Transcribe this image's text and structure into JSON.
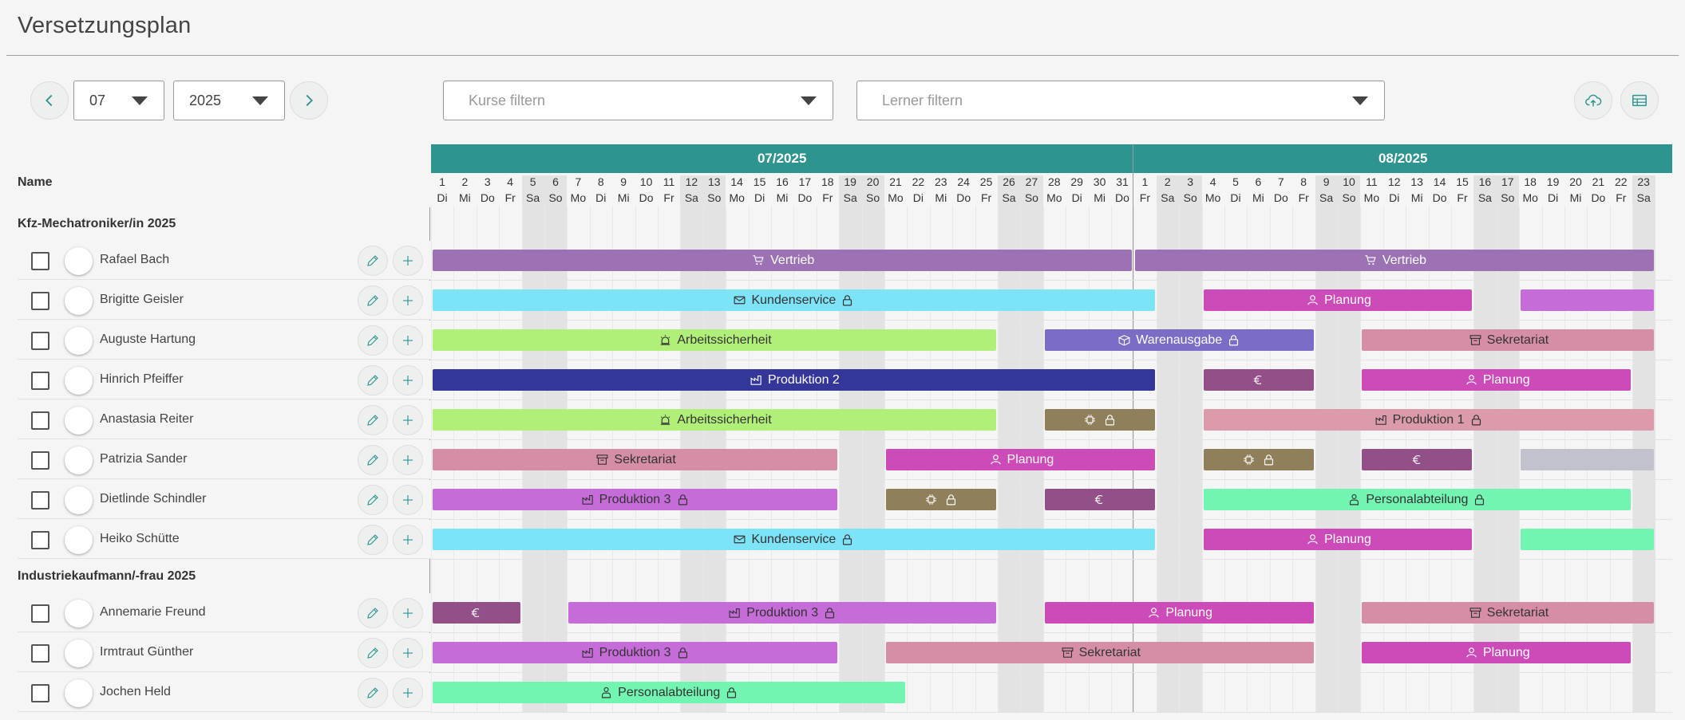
{
  "page_title": "Versetzungsplan",
  "toolbar": {
    "month_value": "07",
    "year_value": "2025",
    "courses_filter_placeholder": "Kurse filtern",
    "learners_filter_placeholder": "Lerner filtern",
    "prev_icon": "chevron-left-icon",
    "next_icon": "chevron-right-icon",
    "upload_icon": "cloud-upload-icon",
    "table_icon": "table-icon"
  },
  "name_column_header": "Name",
  "months": [
    {
      "label": "07/2025",
      "start_day": 1,
      "days": 31,
      "first_weekday_index": 1
    },
    {
      "label": "08/2025",
      "start_day": 1,
      "days": 23,
      "first_weekday_index": 4
    }
  ],
  "weekday_labels": [
    "Mo",
    "Di",
    "Mi",
    "Do",
    "Fr",
    "Sa",
    "So"
  ],
  "groups": [
    {
      "label": "Kfz-Mechatroniker/in 2025",
      "rows": [
        {
          "name": "Rafael Bach",
          "bars": [
            {
              "start": 0,
              "end": 31,
              "label": "Vertrieb",
              "icon": "cart-icon",
              "locked": false,
              "color": "#9c72b5",
              "text": "#ffffff"
            },
            {
              "start": 31,
              "end": 54,
              "label": "Vertrieb",
              "icon": "cart-icon",
              "locked": false,
              "color": "#9c72b5",
              "text": "#ffffff"
            }
          ]
        },
        {
          "name": "Brigitte Geisler",
          "bars": [
            {
              "start": 0,
              "end": 32,
              "label": "Kundenservice",
              "icon": "envelope-icon",
              "locked": true,
              "color": "#7de3f7",
              "text": "#333333"
            },
            {
              "start": 34,
              "end": 46,
              "label": "Planung",
              "icon": "user-icon",
              "locked": false,
              "color": "#cd4bb8",
              "text": "#ffffff"
            },
            {
              "start": 48,
              "end": 54,
              "label": "",
              "icon": "",
              "locked": false,
              "color": "#c66cd9",
              "text": "#ffffff"
            }
          ]
        },
        {
          "name": "Auguste Hartung",
          "bars": [
            {
              "start": 0,
              "end": 25,
              "label": "Arbeitssicherheit",
              "icon": "alarm-icon",
              "locked": false,
              "color": "#b0ef78",
              "text": "#333333"
            },
            {
              "start": 27,
              "end": 39,
              "label": "Warenausgabe",
              "icon": "box-icon",
              "locked": true,
              "color": "#7b6cc6",
              "text": "#ffffff"
            },
            {
              "start": 41,
              "end": 54,
              "label": "Sekretariat",
              "icon": "archive-icon",
              "locked": false,
              "color": "#d58ea6",
              "text": "#333333"
            }
          ]
        },
        {
          "name": "Hinrich Pfeiffer",
          "bars": [
            {
              "start": 0,
              "end": 32,
              "label": "Produktion 2",
              "icon": "factory-icon",
              "locked": false,
              "color": "#35369a",
              "text": "#ffffff"
            },
            {
              "start": 34,
              "end": 39,
              "label": "",
              "icon": "euro-icon",
              "locked": false,
              "color": "#924f88",
              "text": "#ffffff"
            },
            {
              "start": 41,
              "end": 53,
              "label": "Planung",
              "icon": "user-icon",
              "locked": false,
              "color": "#cd4bb8",
              "text": "#ffffff"
            }
          ]
        },
        {
          "name": "Anastasia Reiter",
          "bars": [
            {
              "start": 0,
              "end": 25,
              "label": "Arbeitssicherheit",
              "icon": "alarm-icon",
              "locked": false,
              "color": "#b0ef78",
              "text": "#333333"
            },
            {
              "start": 27,
              "end": 32,
              "label": "",
              "icon": "chip-icon",
              "locked": true,
              "color": "#8f7f5a",
              "text": "#ffffff"
            },
            {
              "start": 34,
              "end": 54,
              "label": "Produktion 1",
              "icon": "factory-icon",
              "locked": true,
              "color": "#db9bab",
              "text": "#333333"
            }
          ]
        },
        {
          "name": "Patrizia Sander",
          "bars": [
            {
              "start": 0,
              "end": 18,
              "label": "Sekretariat",
              "icon": "archive-icon",
              "locked": false,
              "color": "#d58ea6",
              "text": "#333333"
            },
            {
              "start": 20,
              "end": 32,
              "label": "Planung",
              "icon": "user-icon",
              "locked": false,
              "color": "#cd4bb8",
              "text": "#ffffff"
            },
            {
              "start": 34,
              "end": 39,
              "label": "",
              "icon": "chip-icon",
              "locked": true,
              "color": "#8f7f5a",
              "text": "#ffffff"
            },
            {
              "start": 41,
              "end": 46,
              "label": "",
              "icon": "euro-icon",
              "locked": false,
              "color": "#924f88",
              "text": "#ffffff"
            },
            {
              "start": 48,
              "end": 54,
              "label": "",
              "icon": "",
              "locked": false,
              "color": "#c2c2cc",
              "text": "#333333"
            }
          ]
        },
        {
          "name": "Dietlinde Schindler",
          "bars": [
            {
              "start": 0,
              "end": 18,
              "label": "Produktion 3",
              "icon": "factory-icon",
              "locked": true,
              "color": "#c66cd9",
              "text": "#333333"
            },
            {
              "start": 20,
              "end": 25,
              "label": "",
              "icon": "chip-icon",
              "locked": true,
              "color": "#8f7f5a",
              "text": "#ffffff"
            },
            {
              "start": 27,
              "end": 32,
              "label": "",
              "icon": "euro-icon",
              "locked": false,
              "color": "#924f88",
              "text": "#ffffff"
            },
            {
              "start": 34,
              "end": 53,
              "label": "Personalabteilung",
              "icon": "person-icon",
              "locked": true,
              "color": "#72f5b1",
              "text": "#333333"
            }
          ]
        },
        {
          "name": "Heiko Schütte",
          "bars": [
            {
              "start": 0,
              "end": 32,
              "label": "Kundenservice",
              "icon": "envelope-icon",
              "locked": true,
              "color": "#7de3f7",
              "text": "#333333"
            },
            {
              "start": 34,
              "end": 46,
              "label": "Planung",
              "icon": "user-icon",
              "locked": false,
              "color": "#cd4bb8",
              "text": "#ffffff"
            },
            {
              "start": 48,
              "end": 54,
              "label": "",
              "icon": "",
              "locked": false,
              "color": "#72f5b1",
              "text": "#333333"
            }
          ]
        }
      ]
    },
    {
      "label": "Industriekaufmann/-frau 2025",
      "rows": [
        {
          "name": "Annemarie Freund",
          "bars": [
            {
              "start": 0,
              "end": 4,
              "label": "",
              "icon": "euro-icon",
              "locked": false,
              "color": "#924f88",
              "text": "#ffffff"
            },
            {
              "start": 6,
              "end": 25,
              "label": "Produktion 3",
              "icon": "factory-icon",
              "locked": true,
              "color": "#c66cd9",
              "text": "#333333"
            },
            {
              "start": 27,
              "end": 39,
              "label": "Planung",
              "icon": "user-icon",
              "locked": false,
              "color": "#cd4bb8",
              "text": "#ffffff"
            },
            {
              "start": 41,
              "end": 54,
              "label": "Sekretariat",
              "icon": "archive-icon",
              "locked": false,
              "color": "#d58ea6",
              "text": "#333333"
            }
          ]
        },
        {
          "name": "Irmtraut Günther",
          "bars": [
            {
              "start": 0,
              "end": 18,
              "label": "Produktion 3",
              "icon": "factory-icon",
              "locked": true,
              "color": "#c66cd9",
              "text": "#333333"
            },
            {
              "start": 20,
              "end": 39,
              "label": "Sekretariat",
              "icon": "archive-icon",
              "locked": false,
              "color": "#d58ea6",
              "text": "#333333"
            },
            {
              "start": 41,
              "end": 53,
              "label": "Planung",
              "icon": "user-icon",
              "locked": false,
              "color": "#cd4bb8",
              "text": "#ffffff"
            }
          ]
        },
        {
          "name": "Jochen Held",
          "bars": [
            {
              "start": 0,
              "end": 21,
              "label": "Personalabteilung",
              "icon": "person-icon",
              "locked": true,
              "color": "#72f5b1",
              "text": "#333333"
            }
          ]
        }
      ]
    }
  ],
  "row_icons": {
    "edit": "pencil-icon",
    "add": "plus-icon",
    "lock": "lock-icon"
  }
}
